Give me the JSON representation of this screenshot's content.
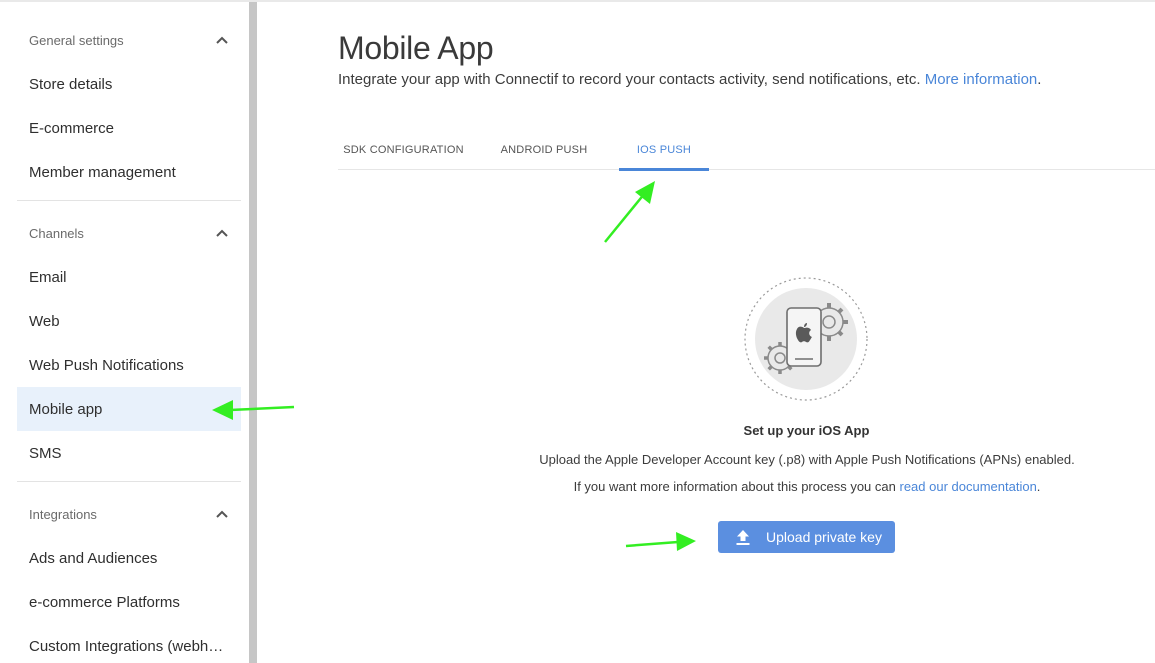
{
  "sidebar": {
    "sections": [
      {
        "title": "General settings",
        "items": [
          "Store details",
          "E-commerce",
          "Member management"
        ]
      },
      {
        "title": "Channels",
        "items": [
          "Email",
          "Web",
          "Web Push Notifications",
          "Mobile app",
          "SMS"
        ]
      },
      {
        "title": "Integrations",
        "items": [
          "Ads and Audiences",
          "e-commerce Platforms",
          "Custom Integrations (webh…"
        ]
      }
    ],
    "active_item": "Mobile app"
  },
  "page": {
    "title": "Mobile App",
    "description": "Integrate your app with Connectif to record your contacts activity, send notifications, etc.",
    "more_info_link": "More information",
    "description_end": "."
  },
  "tabs": [
    {
      "label": "SDK CONFIGURATION",
      "active": false
    },
    {
      "label": "ANDROID PUSH",
      "active": false
    },
    {
      "label": "IOS PUSH",
      "active": true
    }
  ],
  "ios_setup": {
    "illustration_icon": "apple-phone-gears-icon",
    "title": "Set up your iOS App",
    "line1": "Upload the Apple Developer Account key (.p8) with Apple Push Notifications (APNs) enabled.",
    "line2_prefix": "If you want more information about this process you can",
    "line2_link": "read our documentation",
    "line2_suffix": ".",
    "upload_button": "Upload private key",
    "upload_icon": "upload-icon"
  },
  "colors": {
    "accent": "#4a86d8",
    "button": "#5b8fe0",
    "active_nav_bg": "#e8f1fb",
    "annotation_arrow": "#33ee22"
  }
}
